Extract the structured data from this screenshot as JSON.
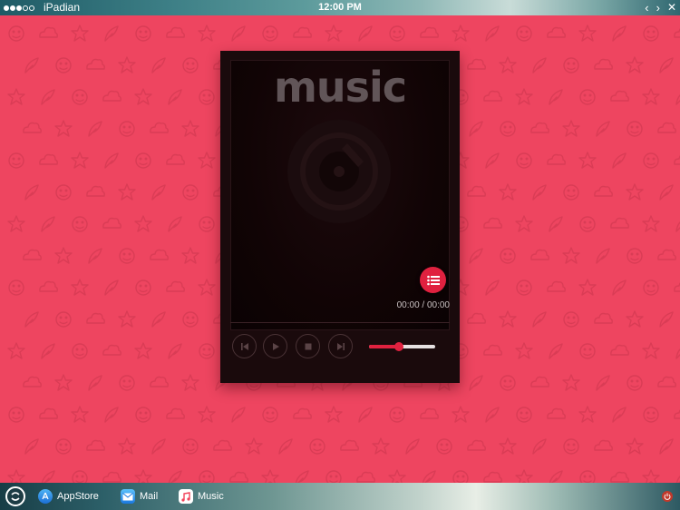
{
  "status_bar": {
    "signal_dots": [
      true,
      true,
      true,
      false,
      false
    ],
    "carrier": "iPadian",
    "time": "12:00 PM",
    "nav": {
      "back_icon": "chevron-left-icon",
      "forward_icon": "chevron-right-icon",
      "close_icon": "close-icon"
    }
  },
  "background": {
    "color": "#ee4560",
    "pattern": "faint outline doodle icons (smileys, clouds, stars, feathers)"
  },
  "player": {
    "title": "music",
    "album_icon": "vinyl-disc-icon",
    "playlist_icon": "list-icon",
    "time_display": "00:00 / 00:00",
    "controls": [
      {
        "name": "previous",
        "icon": "skip-back-icon"
      },
      {
        "name": "play",
        "icon": "play-icon"
      },
      {
        "name": "stop",
        "icon": "stop-icon"
      },
      {
        "name": "next",
        "icon": "skip-forward-icon"
      }
    ],
    "volume": 0.45,
    "accent_color": "#e0213f"
  },
  "dock": {
    "start_icon": "ipadian-logo-icon",
    "apps": [
      {
        "label": "AppStore",
        "icon": "appstore-icon"
      },
      {
        "label": "Mail",
        "icon": "mail-icon"
      },
      {
        "label": "Music",
        "icon": "music-note-icon"
      }
    ],
    "power_icon": "power-icon"
  }
}
